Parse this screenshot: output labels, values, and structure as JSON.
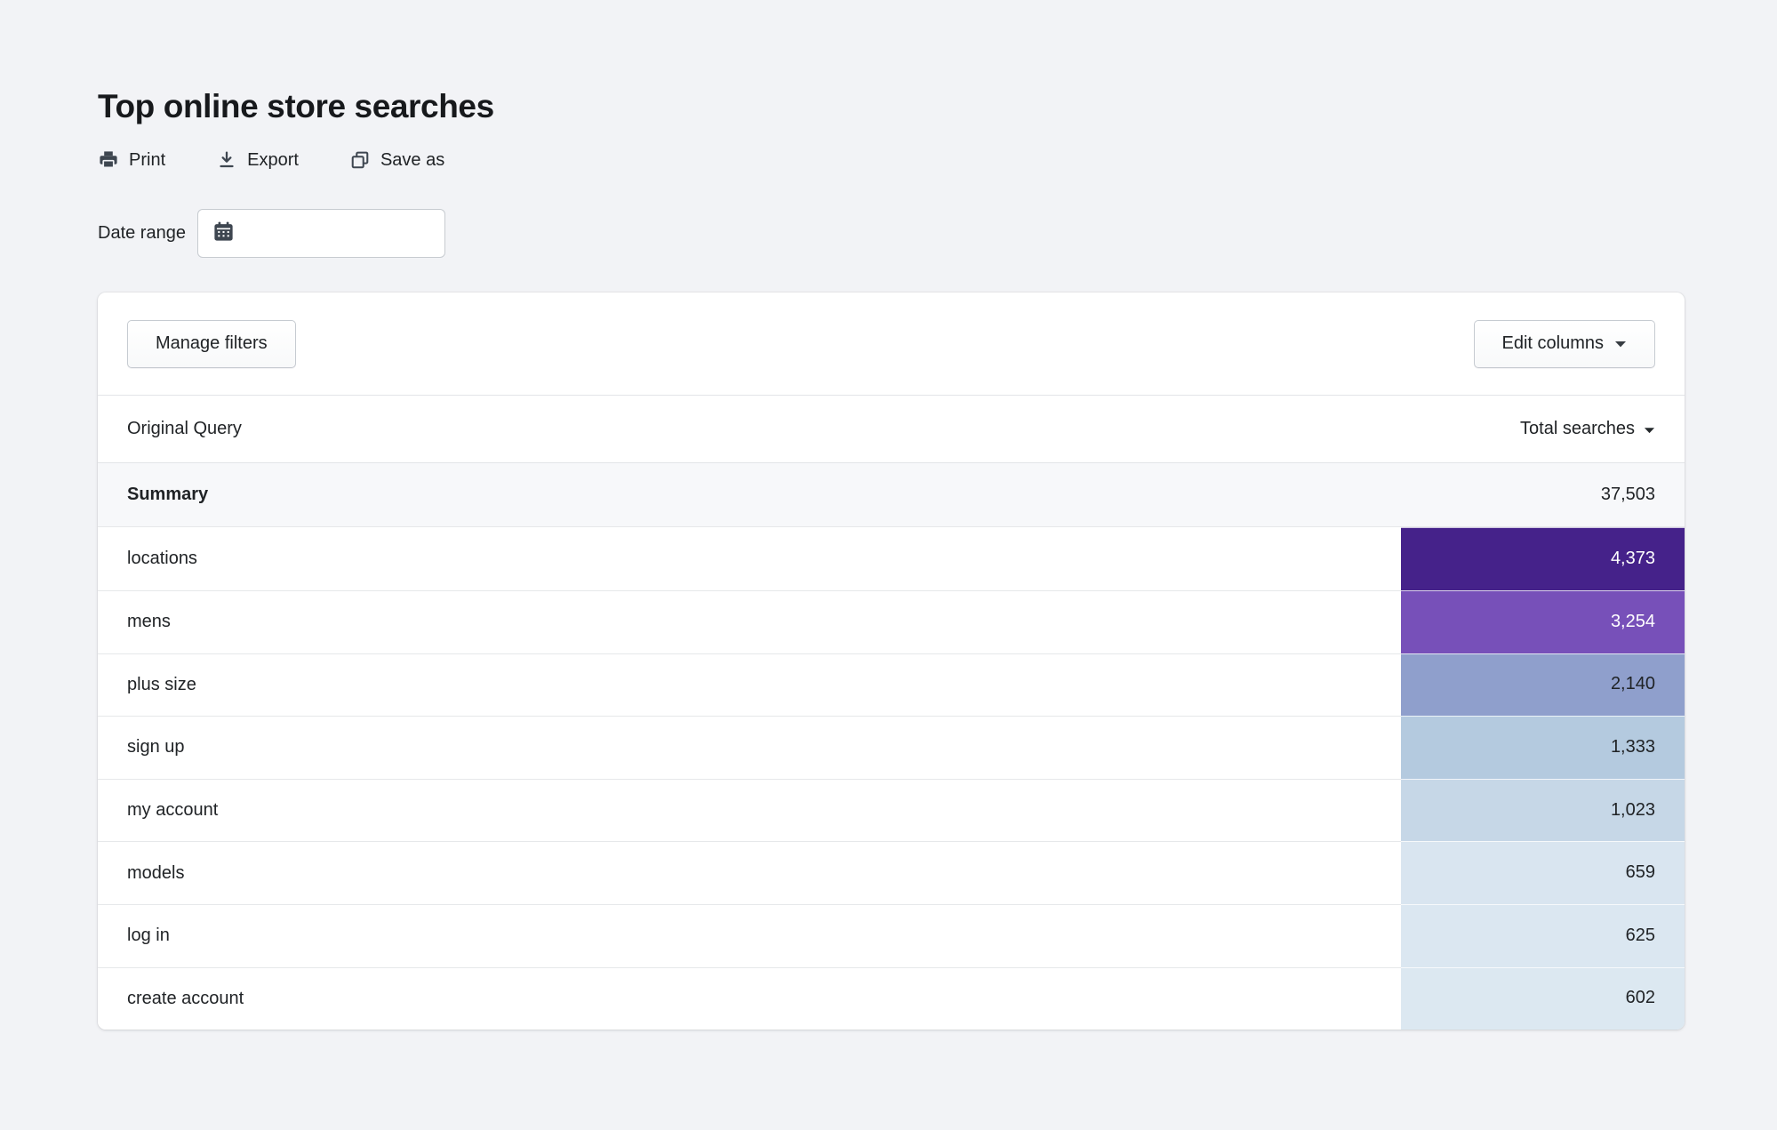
{
  "page": {
    "title": "Top online store searches"
  },
  "actions": {
    "print_label": "Print",
    "export_label": "Export",
    "save_as_label": "Save as"
  },
  "filters": {
    "date_range_label": "Date range",
    "date_input_value": ""
  },
  "panel": {
    "manage_filters_label": "Manage filters",
    "edit_columns_label": "Edit columns"
  },
  "table": {
    "header": {
      "query_column": "Original Query",
      "total_column": "Total searches",
      "sort_direction": "desc"
    },
    "summary": {
      "label": "Summary",
      "value": "37,503"
    },
    "rows": [
      {
        "query": "locations",
        "value": "4,373",
        "bg": "#45228a",
        "text": "#ffffff"
      },
      {
        "query": "mens",
        "value": "3,254",
        "bg": "#7750b9",
        "text": "#ffffff"
      },
      {
        "query": "plus size",
        "value": "2,140",
        "bg": "#8f9fcc",
        "text": "#202326"
      },
      {
        "query": "sign up",
        "value": "1,333",
        "bg": "#b4cadf",
        "text": "#202326"
      },
      {
        "query": "my account",
        "value": "1,023",
        "bg": "#c6d7e7",
        "text": "#202326"
      },
      {
        "query": "models",
        "value": "659",
        "bg": "#d9e5f0",
        "text": "#202326"
      },
      {
        "query": "log in",
        "value": "625",
        "bg": "#dbe7f1",
        "text": "#202326"
      },
      {
        "query": "create account",
        "value": "602",
        "bg": "#dce8f1",
        "text": "#202326"
      }
    ]
  },
  "colors": {
    "page_background": "#f2f3f6",
    "icon_slate": "#3e4650",
    "summary_background": "#f7f8fa"
  },
  "icons": {
    "print": "printer-icon",
    "export": "download-icon",
    "save_as": "duplicate-icon",
    "date": "calendar-icon",
    "sort": "caret-down-icon"
  }
}
